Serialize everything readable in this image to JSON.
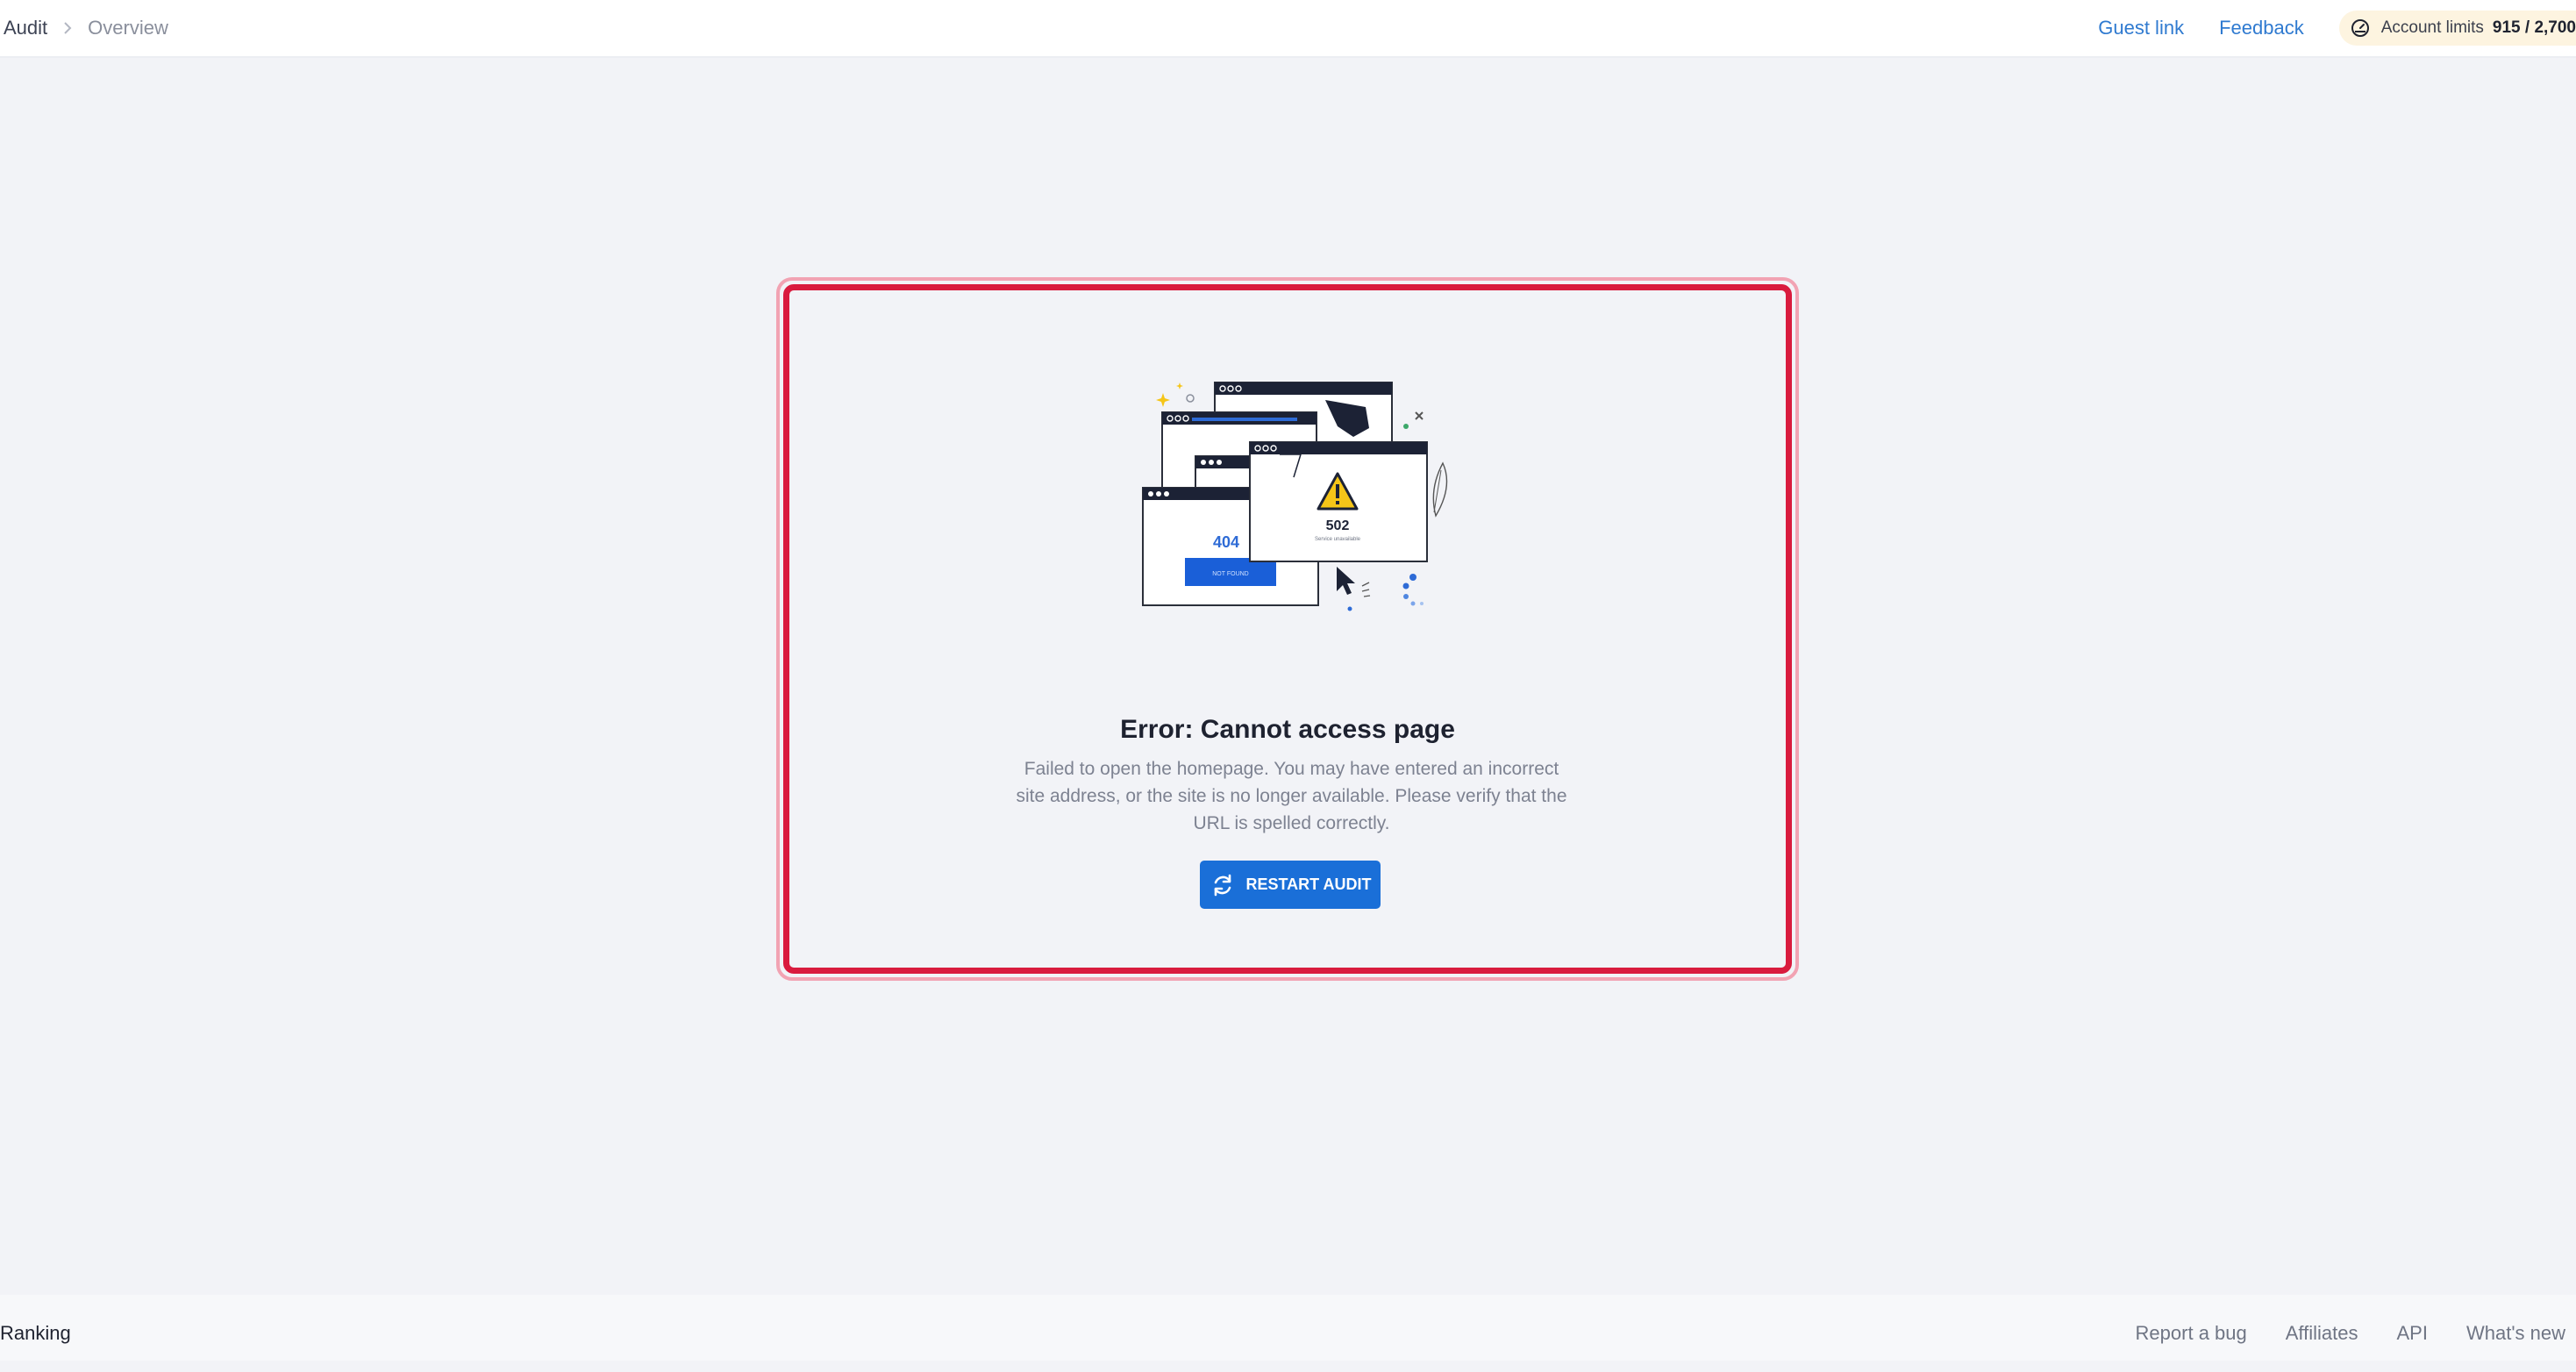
{
  "header": {
    "breadcrumb": {
      "root": "Audit",
      "current": "Overview"
    },
    "nav": {
      "guest_link": "Guest link",
      "feedback": "Feedback"
    },
    "account_limits": {
      "label": "Account limits",
      "value": "915 / 2,700"
    }
  },
  "error": {
    "title": "Error: Cannot access page",
    "description": "Failed to open the homepage. You may have entered an incorrect site address, or the site is no longer available. Please verify that the URL is spelled correctly.",
    "button_label": "RESTART AUDIT",
    "illustration": {
      "code_404": "404",
      "button_404": "NOT FOUND",
      "code_502": "502",
      "subtitle_502": "Service unavailable"
    }
  },
  "footer": {
    "left_label": "Ranking",
    "links": [
      "Report a bug",
      "Affiliates",
      "API",
      "What's new"
    ]
  },
  "colors": {
    "accent": "#1a6fd8",
    "link": "#2f7ad0",
    "error_border": "#d91b3e",
    "error_glow": "#f2a3b3",
    "background": "#f2f3f7",
    "limits_bg": "#fdf4e0"
  },
  "icons": {
    "breadcrumb_separator": "chevron-right-icon",
    "account_limits": "gauge-icon",
    "restart": "refresh-icon",
    "illustration_warning": "warning-triangle-icon"
  }
}
